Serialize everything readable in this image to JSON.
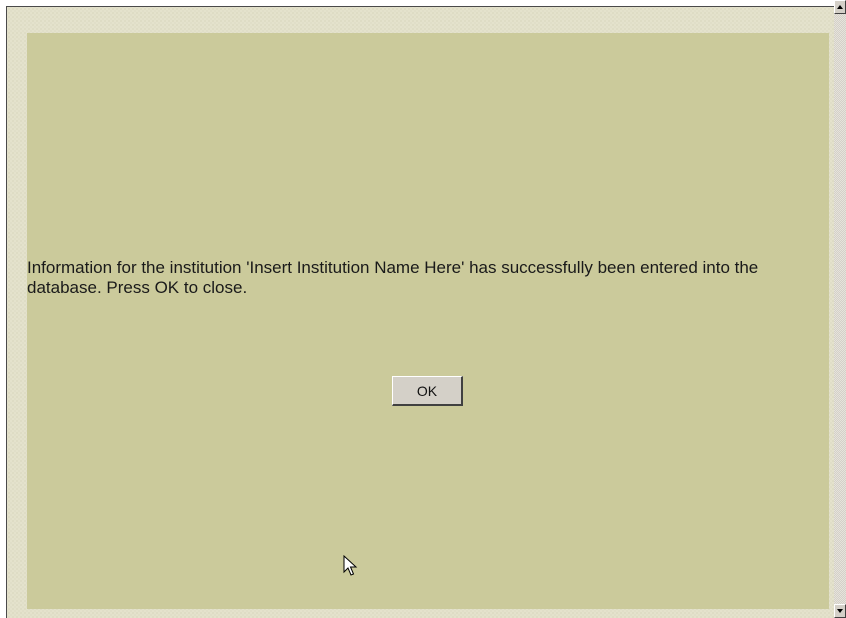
{
  "dialog": {
    "message": "Information for the institution 'Insert Institution Name Here' has successfully been entered into the database. Press OK to close.",
    "ok_label": "OK"
  },
  "colors": {
    "panel_background": "#cbca9b",
    "outer_background": "#e4e2cc",
    "button_face": "#d4d0c8"
  },
  "icons": {
    "pointer": "mouse-pointer-icon",
    "scroll_up": "scroll-up-arrow-icon",
    "scroll_down": "scroll-down-arrow-icon"
  }
}
